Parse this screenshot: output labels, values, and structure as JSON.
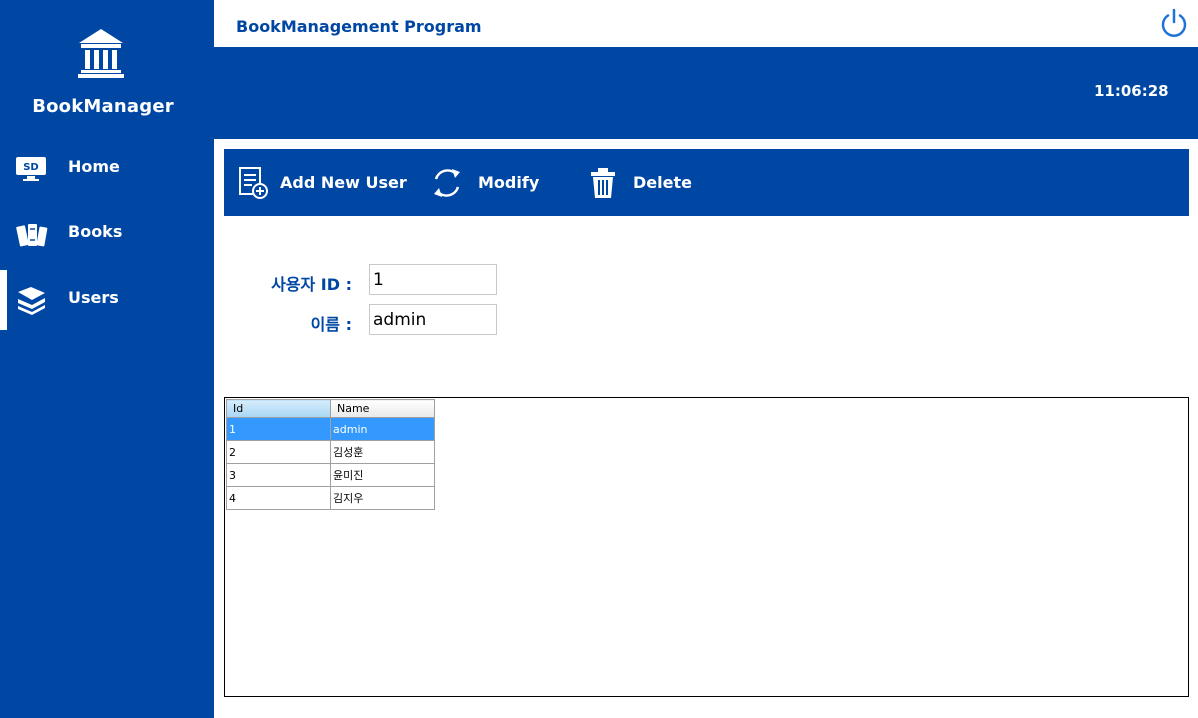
{
  "app": {
    "logo_text": "BookManager",
    "title": "BookManagement Program",
    "clock": "11:06:28"
  },
  "sidebar": {
    "items": [
      {
        "label": "Home",
        "icon": "home-monitor-icon",
        "active": false
      },
      {
        "label": "Books",
        "icon": "books-icon",
        "active": false
      },
      {
        "label": "Users",
        "icon": "users-book-stack-icon",
        "active": true
      }
    ]
  },
  "toolbar": {
    "add_label": "Add New User",
    "modify_label": "Modify",
    "delete_label": "Delete"
  },
  "form": {
    "id_label": "사용자 ID :",
    "id_value": "1",
    "name_label": "이름 :",
    "name_value": "admin"
  },
  "grid": {
    "columns": [
      "Id",
      "Name"
    ],
    "rows": [
      {
        "id": "1",
        "name": "admin",
        "selected": true
      },
      {
        "id": "2",
        "name": "김성훈",
        "selected": false
      },
      {
        "id": "3",
        "name": "윤미진",
        "selected": false
      },
      {
        "id": "4",
        "name": "김지우",
        "selected": false
      }
    ]
  },
  "colors": {
    "brand_blue": "#0047a3",
    "selection_blue": "#3399ff"
  }
}
